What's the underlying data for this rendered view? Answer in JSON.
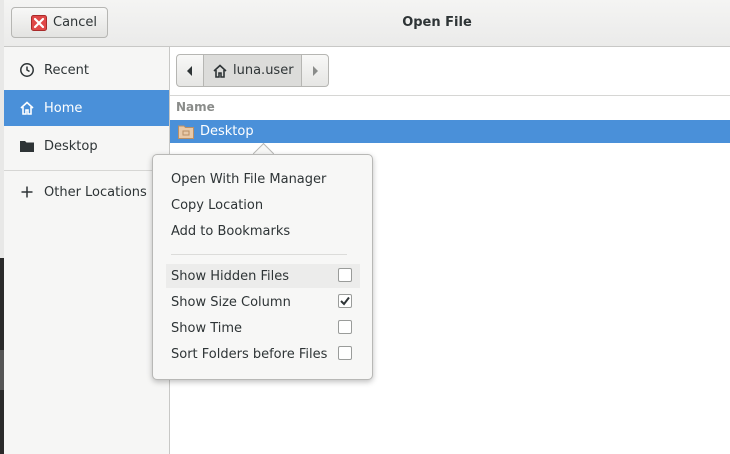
{
  "window": {
    "title": "Open File"
  },
  "header": {
    "cancel_label": "Cancel"
  },
  "sidebar": {
    "items": [
      {
        "label": "Recent",
        "icon": "clock-icon"
      },
      {
        "label": "Home",
        "icon": "home-icon",
        "active": true
      },
      {
        "label": "Desktop",
        "icon": "folder-icon"
      },
      {
        "label": "Other Locations",
        "icon": "plus-icon"
      }
    ]
  },
  "pathbar": {
    "current": "luna.user"
  },
  "file_list": {
    "column_header": "Name",
    "rows": [
      {
        "name": "Desktop",
        "selected": true
      }
    ]
  },
  "context_menu": {
    "actions": [
      "Open With File Manager",
      "Copy Location",
      "Add to Bookmarks"
    ],
    "toggles": [
      {
        "label": "Show Hidden Files",
        "checked": false
      },
      {
        "label": "Show Size Column",
        "checked": true
      },
      {
        "label": "Show Time",
        "checked": false
      },
      {
        "label": "Sort Folders before Files",
        "checked": false
      }
    ]
  },
  "colors": {
    "accent": "#4a90d9",
    "cancel_icon": "#cc3a3a"
  }
}
